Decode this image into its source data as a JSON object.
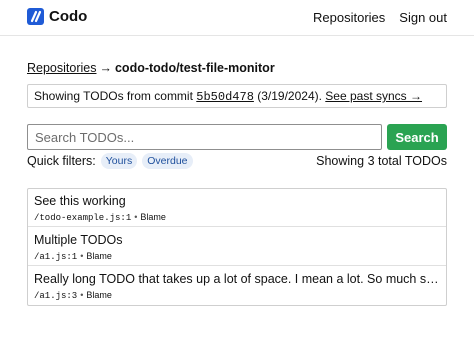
{
  "brand": {
    "name": "Codo",
    "icon": "codo-logo-icon",
    "color": "#1f5bd6"
  },
  "nav": [
    {
      "label": "Repositories"
    },
    {
      "label": "Sign out"
    }
  ],
  "breadcrumb": {
    "link": "Repositories",
    "arrow": "→",
    "current": "codo-todo/test-file-monitor"
  },
  "info": {
    "prefix": "Showing TODOs from commit",
    "commit": "5b50d478",
    "date": "(3/19/2024).",
    "past_syncs": "See past syncs →"
  },
  "search": {
    "placeholder": "Search TODOs...",
    "value": "",
    "button_label": "Search",
    "button_color": "#2aa352"
  },
  "filters": {
    "label": "Quick filters:",
    "chips": [
      {
        "label": "Yours"
      },
      {
        "label": "Overdue"
      }
    ]
  },
  "summary": {
    "total": "Showing 3 total TODOs"
  },
  "todos": [
    {
      "title": "See this working",
      "path": "/todo-example.js:1",
      "separator": "•",
      "blame": "Blame"
    },
    {
      "title": "Multiple TODOs",
      "path": "/a1.js:1",
      "separator": "•",
      "blame": "Blame"
    },
    {
      "title": "Really long TODO that takes up a lot of space. I mean a lot. So much space. Big...",
      "path": "/a1.js:3",
      "separator": "•",
      "blame": "Blame"
    }
  ]
}
